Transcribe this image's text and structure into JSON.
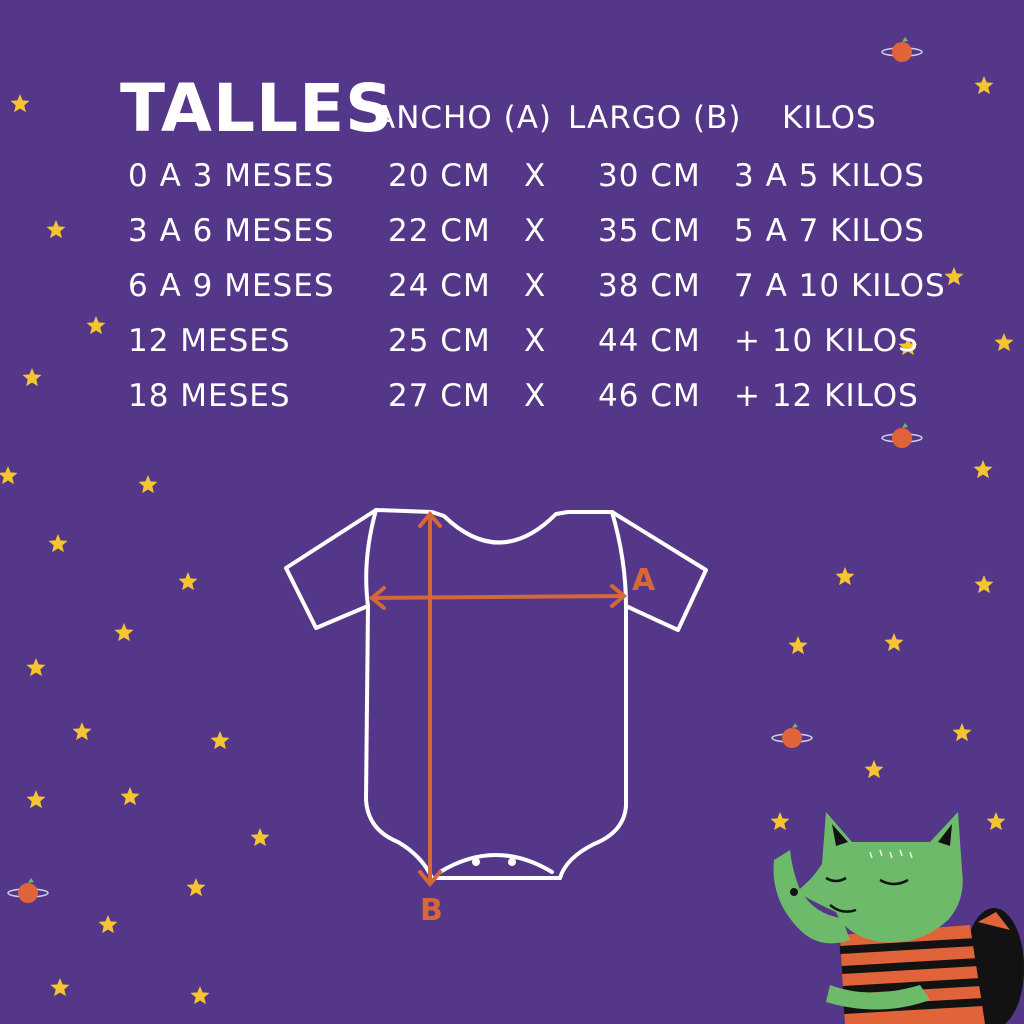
{
  "title": "TALLES",
  "headers": {
    "ancho": "ANCHO (A)",
    "largo": "LARGO (B)",
    "kilos": "KILOS"
  },
  "rows": [
    {
      "size": "0 A 3 MESES",
      "ancho": "20 CM",
      "sep": "X",
      "largo": "30 CM",
      "kilos": "3 A 5 KILOS"
    },
    {
      "size": "3 A 6 MESES",
      "ancho": "22 CM",
      "sep": "X",
      "largo": "35 CM",
      "kilos": "5 A 7 KILOS"
    },
    {
      "size": "6 A 9 MESES",
      "ancho": "24 CM",
      "sep": "X",
      "largo": "38 CM",
      "kilos": "7 A 10 KILOS"
    },
    {
      "size": "12 MESES",
      "ancho": "25 CM",
      "sep": "X",
      "largo": "44 CM",
      "kilos": "+ 10 KILOS"
    },
    {
      "size": "18 MESES",
      "ancho": "27 CM",
      "sep": "X",
      "largo": "46 CM",
      "kilos": "+ 12 KILOS"
    }
  ],
  "diagram": {
    "label_a": "A",
    "label_b": "B"
  },
  "icons": [
    "star-icon",
    "planet-icon",
    "bodysuit-outline-icon",
    "wolf-character-illustration"
  ],
  "colors": {
    "background": "#55378a",
    "text": "#ffffff",
    "star": "#f5c531",
    "measure": "#d4683a",
    "planet": "#e0633a",
    "wolf": "#6dbb6a"
  }
}
